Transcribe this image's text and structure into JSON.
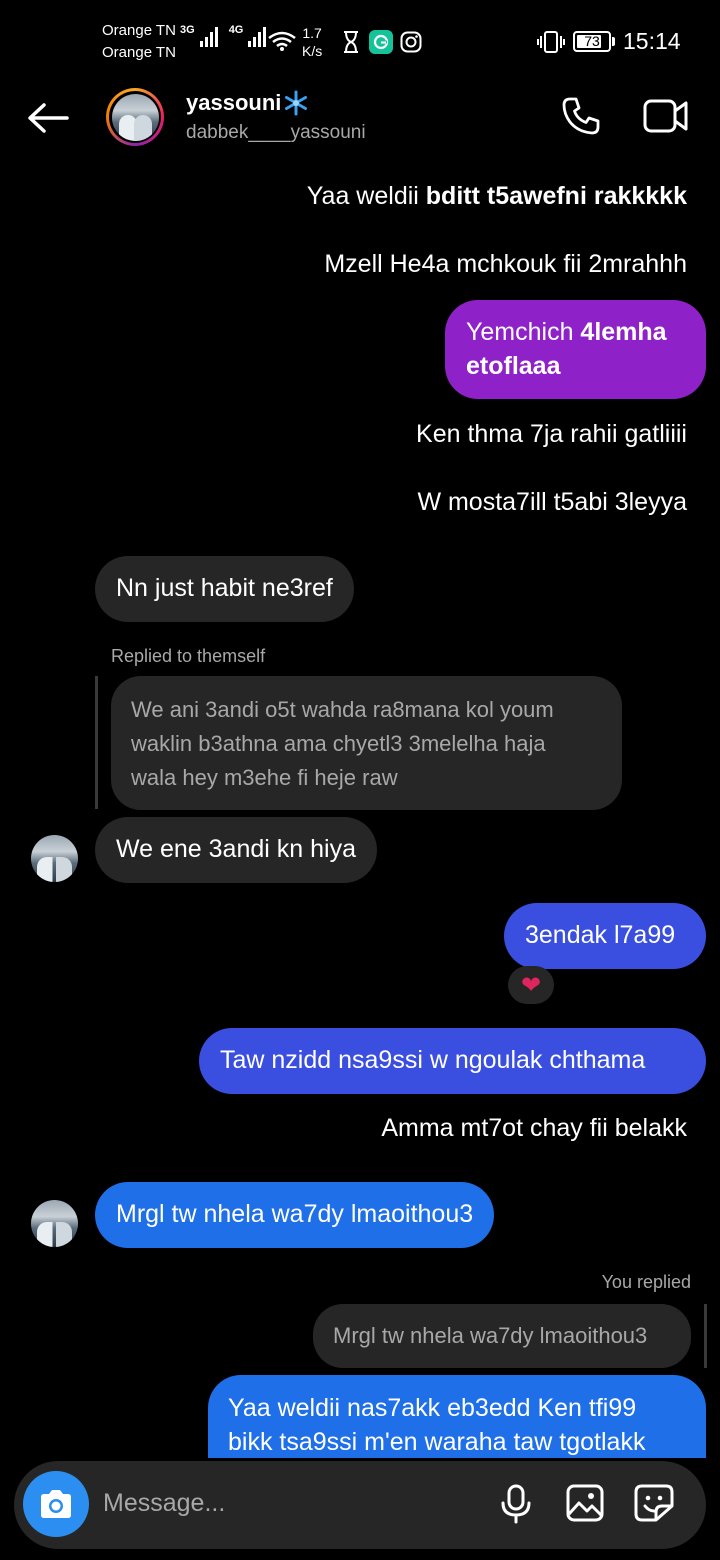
{
  "status_bar": {
    "carrier_1": "Orange TN",
    "carrier_2": "Orange TN",
    "net_1": "3G",
    "net_2": "4G",
    "speed_value": "1.7",
    "speed_unit": "K/s",
    "battery": "73",
    "time": "15:14"
  },
  "header": {
    "name": "yassouni",
    "handle": "dabbek____yassouni"
  },
  "messages": {
    "m1_normal": "Yaa weldii ",
    "m1_bold": "bditt t5awefni rakkkkk",
    "m2": "Mzell He4a mchkouk fii 2mrahhh",
    "m3_line1_normal": "Yemchich ",
    "m3_line1_bold": "4lemha",
    "m3_line2_bold": "etoflaaa",
    "m4": "Ken thma 7ja rahii gatliiii",
    "m5": "W mosta7ill t5abi 3leyya",
    "m6": "Nn just habit ne3ref",
    "reply1_label": "Replied to themself",
    "reply1_line1": "We ani 3andi o5t wahda ra8mana kol youm",
    "reply1_line2": "waklin b3athna ama chyetl3 3melelha haja",
    "reply1_line3": "wala hey m3ehe fi heje raw",
    "m7": "We ene 3andi kn hiya",
    "m8": "3endak l7a99",
    "m8_reaction": "❤",
    "m9": "Taw nzidd nsa9ssi w ngoulak chthama",
    "m10": "Amma mt7ot chay fii belakk",
    "m11": "Mrgl tw nhela wa7dy lmaoithou3",
    "reply2_label": "You replied",
    "reply2_quote": "Mrgl tw nhela wa7dy lmaoithou3",
    "m12_line1": "Yaa weldii nas7akk eb3edd Ken tfi99",
    "m12_line2": "bikk tsa9ssi m'en waraha taw tgotlakk"
  },
  "composer": {
    "placeholder": "Message..."
  }
}
